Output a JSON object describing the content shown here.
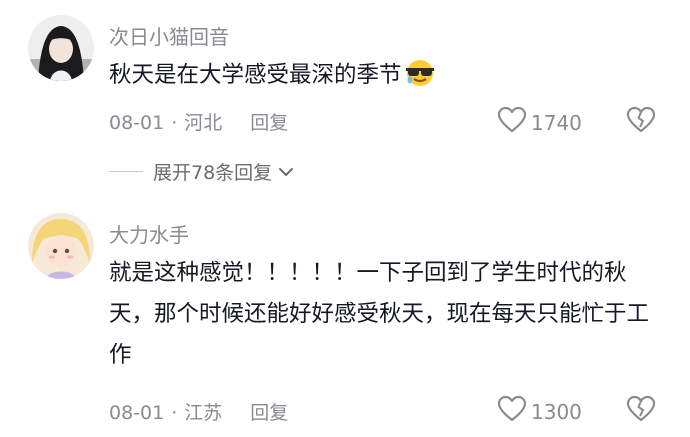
{
  "comments": [
    {
      "username": "次日小猫回音",
      "text": "秋天是在大学感受最深的季节",
      "emoji": "cool-sunglasses-emoji",
      "date": "08-01",
      "separator": "·",
      "location": "河北",
      "reply_label": "回复",
      "likes": "1740"
    },
    {
      "username": "大力水手",
      "text": "就是这种感觉！！！！！一下子回到了学生时代的秋天，那个时候还能好好感受秋天，现在每天只能忙于工作",
      "date": "08-01",
      "separator": "·",
      "location": "江苏",
      "reply_label": "回复",
      "likes": "1300"
    }
  ],
  "expand_replies": "展开78条回复",
  "colors": {
    "text": "#161823",
    "secondary": "#8a8b91",
    "background": "#ffffff"
  }
}
